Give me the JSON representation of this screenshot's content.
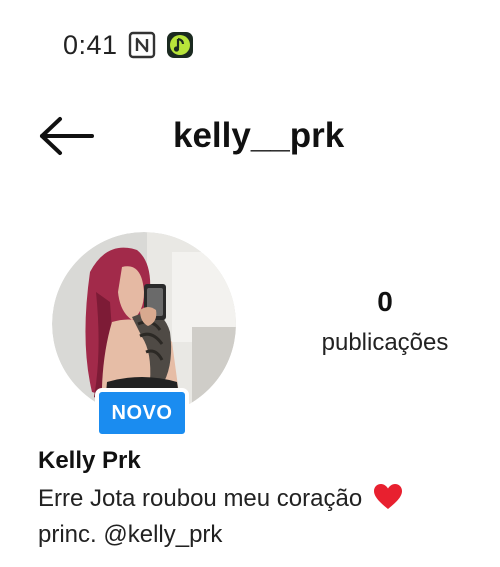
{
  "status_bar": {
    "time": "0:41",
    "icons": [
      "nfc-icon",
      "music-app-icon"
    ]
  },
  "header": {
    "back_icon": "arrow-left-icon",
    "username": "kelly__prk"
  },
  "profile": {
    "badge": "NOVO",
    "badge_color": "#1a8cf0",
    "stats": {
      "posts_count": "0",
      "posts_label": "publicações"
    },
    "full_name": "Kelly Prk",
    "bio_line_1": "Erre Jota roubou meu coração",
    "bio_line_1_icon": "heart-icon",
    "bio_line_2": "princ. @kelly_prk"
  }
}
